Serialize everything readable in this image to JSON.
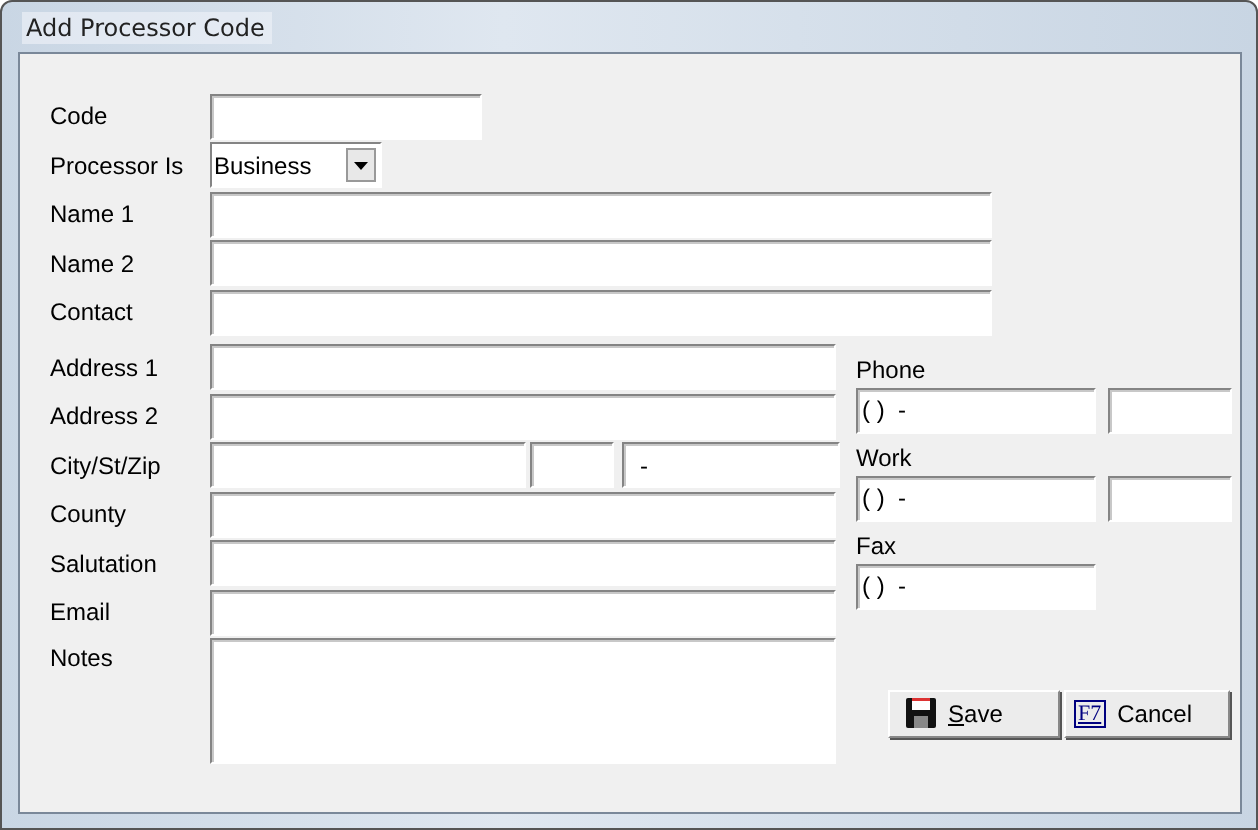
{
  "window": {
    "title": "Add Processor Code"
  },
  "top_fields": [
    {
      "label": "Code",
      "kind": "short"
    },
    {
      "label": "Processor Is",
      "kind": "select",
      "value": "Business"
    },
    {
      "label": "Name 1",
      "kind": "wide"
    },
    {
      "label": "Name 2",
      "kind": "wide"
    },
    {
      "label": "Contact",
      "kind": "wide"
    }
  ],
  "address_fields": [
    {
      "label": "Address 1",
      "kind": "text"
    },
    {
      "label": "Address 2",
      "kind": "text"
    },
    {
      "label": "City/St/Zip",
      "kind": "citystzip",
      "zip": "-"
    },
    {
      "label": "County",
      "kind": "text"
    },
    {
      "label": "Salutation",
      "kind": "text"
    },
    {
      "label": "Email",
      "kind": "text"
    },
    {
      "label": "Notes",
      "kind": "notes"
    }
  ],
  "phone_fields": [
    {
      "label": "Phone",
      "value": "( )  -",
      "extension": true
    },
    {
      "label": "Work",
      "value": "( )  -",
      "extension": true
    },
    {
      "label": "Fax",
      "value": "( )  -",
      "extension": false
    }
  ],
  "buttons": [
    {
      "kind": "save",
      "label": "Save",
      "underline_first": true
    },
    {
      "kind": "cancel",
      "label": "Cancel",
      "key": "F7",
      "underline_first": false
    }
  ]
}
